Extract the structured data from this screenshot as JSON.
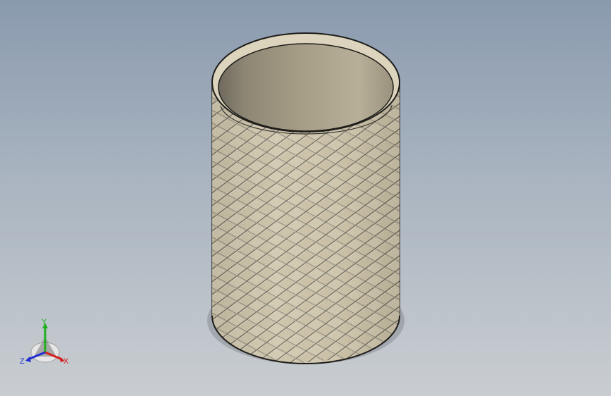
{
  "viewport": {
    "background_top": "#8a9aae",
    "background_bottom": "#c9cdd1"
  },
  "model": {
    "type": "knurled cylindrical sleeve",
    "body_color": "#d6ccb4",
    "inner_color": "#a39c84",
    "knurl_pattern": "diamond"
  },
  "triad": {
    "x_label": "X",
    "y_label": "Y",
    "z_label": "Z",
    "x_color": "#d42020",
    "y_color": "#20b020",
    "z_color": "#2030d0"
  }
}
